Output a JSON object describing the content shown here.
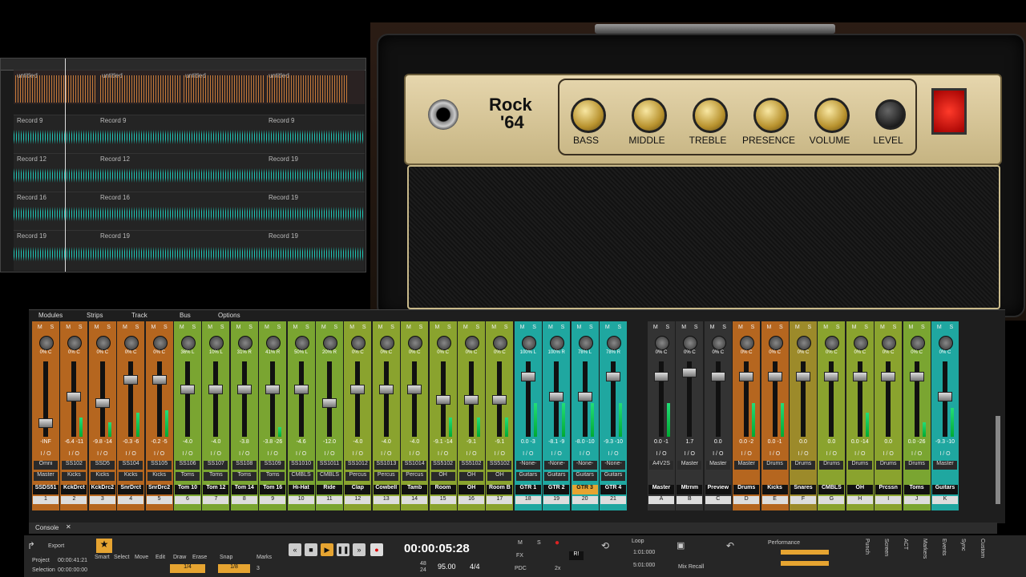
{
  "trackview": {
    "bus_clips": [
      {
        "label": "untitled"
      },
      {
        "label": "untitled"
      },
      {
        "label": "untitled"
      },
      {
        "label": "untitled"
      }
    ],
    "tracks": [
      {
        "clips": [
          "Record 9",
          "Record 9",
          "Record 9"
        ]
      },
      {
        "clips": [
          "Record 12",
          "Record 12",
          "Record 19"
        ]
      },
      {
        "clips": [
          "Record 16",
          "Record 16",
          "Record 19"
        ]
      },
      {
        "clips": [
          "Record 19",
          "Record 19",
          "Record 19"
        ]
      }
    ]
  },
  "amp": {
    "title_line1": "Rock",
    "title_line2": "'64",
    "knobs": [
      "BASS",
      "MIDDLE",
      "TREBLE",
      "PRESENCE",
      "VOLUME",
      "LEVEL"
    ]
  },
  "console": {
    "menu": [
      "Modules",
      "Strips",
      "Track",
      "Bus",
      "Options"
    ],
    "tab": "Console",
    "io_label": "I / O",
    "strips": [
      {
        "pot": "0% C",
        "vals": "-INF",
        "in": "Omni",
        "out": "Master",
        "name": "SSDS51",
        "num": "1",
        "color": "#b5661f",
        "fader": 0.85,
        "meter": 0
      },
      {
        "pot": "0% C",
        "vals": "-6.4 -11",
        "in": "SS102",
        "out": "Kicks",
        "name": "KckDrct",
        "num": "2",
        "color": "#b5661f",
        "fader": 0.45,
        "meter": 0.4
      },
      {
        "pot": "0% C",
        "vals": "-9.8 -14",
        "in": "SSD5",
        "out": "Kicks",
        "name": "KckDrc2",
        "num": "3",
        "color": "#b5661f",
        "fader": 0.55,
        "meter": 0.3
      },
      {
        "pot": "0% C",
        "vals": "-0.3 -6",
        "in": "SS104",
        "out": "Kicks",
        "name": "SnrDrct",
        "num": "4",
        "color": "#b5661f",
        "fader": 0.2,
        "meter": 0.5
      },
      {
        "pot": "0% C",
        "vals": "-0.2 -5",
        "in": "SS105",
        "out": "Kicks",
        "name": "SnrDrc2",
        "num": "5",
        "color": "#b5661f",
        "fader": 0.2,
        "meter": 0.55
      },
      {
        "pot": "36% L",
        "vals": "-4.0",
        "in": "SS106",
        "out": "Toms",
        "name": "Tom 10",
        "num": "6",
        "color": "#7aa531",
        "fader": 0.35,
        "meter": 0
      },
      {
        "pot": "10% L",
        "vals": "-4.0",
        "in": "SS107",
        "out": "Toms",
        "name": "Tom 12",
        "num": "7",
        "color": "#7aa531",
        "fader": 0.35,
        "meter": 0
      },
      {
        "pot": "31% R",
        "vals": "-3.8",
        "in": "SS108",
        "out": "Toms",
        "name": "Tom 14",
        "num": "8",
        "color": "#7aa531",
        "fader": 0.35,
        "meter": 0
      },
      {
        "pot": "41% R",
        "vals": "-3.8 -26",
        "in": "SS109",
        "out": "Toms",
        "name": "Tom 16",
        "num": "9",
        "color": "#7aa531",
        "fader": 0.35,
        "meter": 0.2
      },
      {
        "pot": "50% L",
        "vals": "-4.6",
        "in": "SS1010",
        "out": "CMBLS",
        "name": "Hi-Hat",
        "num": "10",
        "color": "#7aa531",
        "fader": 0.35,
        "meter": 0
      },
      {
        "pot": "20% R",
        "vals": "-12.0",
        "in": "SS1011",
        "out": "CMBLS",
        "name": "Ride",
        "num": "11",
        "color": "#7aa531",
        "fader": 0.55,
        "meter": 0
      },
      {
        "pot": "0% C",
        "vals": "-4.0",
        "in": "SS1012",
        "out": "Percus",
        "name": "Clap",
        "num": "12",
        "color": "#8aa32e",
        "fader": 0.35,
        "meter": 0
      },
      {
        "pot": "0% C",
        "vals": "-4.0",
        "in": "SS1013",
        "out": "Percus",
        "name": "Cowbell",
        "num": "13",
        "color": "#8aa32e",
        "fader": 0.35,
        "meter": 0
      },
      {
        "pot": "0% C",
        "vals": "-4.0",
        "in": "SS1014",
        "out": "Percus",
        "name": "Tamb",
        "num": "14",
        "color": "#8aa32e",
        "fader": 0.35,
        "meter": 0
      },
      {
        "pot": "0% C",
        "vals": "-9.1 -14",
        "in": "SS5102",
        "out": "OH",
        "name": "Room",
        "num": "15",
        "color": "#8aa32e",
        "fader": 0.5,
        "meter": 0.4
      },
      {
        "pot": "0% C",
        "vals": "-9.1",
        "in": "SS5102",
        "out": "OH",
        "name": "OH",
        "num": "16",
        "color": "#8aa32e",
        "fader": 0.5,
        "meter": 0.4
      },
      {
        "pot": "0% C",
        "vals": "-9.1",
        "in": "SS5102",
        "out": "OH",
        "name": "Room B",
        "num": "17",
        "color": "#8aa32e",
        "fader": 0.5,
        "meter": 0.4
      },
      {
        "pot": "100% L",
        "vals": "0.0 -3",
        "in": "-None-",
        "out": "Guitars",
        "name": "GTR 1",
        "num": "18",
        "color": "#1fa7a0",
        "fader": 0.15,
        "meter": 0.7
      },
      {
        "pot": "100% R",
        "vals": "-8.1 -9",
        "in": "-None-",
        "out": "Guitars",
        "name": "GTR 2",
        "num": "19",
        "color": "#1fa7a0",
        "fader": 0.45,
        "meter": 0.7
      },
      {
        "pot": "78% L",
        "vals": "-8.0 -10",
        "in": "-None-",
        "out": "Guitars",
        "name": "GTR 3",
        "num": "20",
        "color": "#1fa7a0",
        "fader": 0.45,
        "meter": 0.7,
        "highlight": true
      },
      {
        "pot": "78% R",
        "vals": "-9.3 -10",
        "in": "-None-",
        "out": "Guitars",
        "name": "GTR 4",
        "num": "21",
        "color": "#1fa7a0",
        "fader": 0.15,
        "meter": 0.7
      }
    ],
    "buses": [
      {
        "pot": "0% C",
        "vals": "0.0 -1",
        "in": "A4V2S",
        "out": "",
        "name": "Master",
        "num": "A",
        "color": "#333",
        "fader": 0.15,
        "meter": 0.7
      },
      {
        "pot": "0% C",
        "vals": "1.7",
        "in": "Master",
        "out": "",
        "name": "Mtrnm",
        "num": "B",
        "color": "#333",
        "fader": 0.1,
        "meter": 0
      },
      {
        "pot": "0% C",
        "vals": "0.0",
        "in": "Master",
        "out": "",
        "name": "Preview",
        "num": "C",
        "color": "#333",
        "fader": 0.15,
        "meter": 0
      },
      {
        "pot": "0% C",
        "vals": "0.0 -2",
        "in": "Master",
        "out": "",
        "name": "Drums",
        "num": "D",
        "color": "#b5661f",
        "fader": 0.15,
        "meter": 0.7
      },
      {
        "pot": "0% C",
        "vals": "0.0 -1",
        "in": "Drums",
        "out": "",
        "name": "Kicks",
        "num": "E",
        "color": "#b5661f",
        "fader": 0.15,
        "meter": 0.7
      },
      {
        "pot": "0% C",
        "vals": "0.0",
        "in": "Drums",
        "out": "",
        "name": "Snares",
        "num": "F",
        "color": "#9c8a2a",
        "fader": 0.15,
        "meter": 0
      },
      {
        "pot": "0% C",
        "vals": "0.0",
        "in": "Drums",
        "out": "",
        "name": "CMBLS",
        "num": "G",
        "color": "#8aa32e",
        "fader": 0.15,
        "meter": 0
      },
      {
        "pot": "0% C",
        "vals": "0.0 -14",
        "in": "Drums",
        "out": "",
        "name": "OH",
        "num": "H",
        "color": "#8aa32e",
        "fader": 0.15,
        "meter": 0.5
      },
      {
        "pot": "0% C",
        "vals": "0.0",
        "in": "Drums",
        "out": "",
        "name": "Prcssn",
        "num": "I",
        "color": "#8aa32e",
        "fader": 0.15,
        "meter": 0
      },
      {
        "pot": "0% C",
        "vals": "0.0 -26",
        "in": "Drums",
        "out": "",
        "name": "Toms",
        "num": "J",
        "color": "#7aa531",
        "fader": 0.15,
        "meter": 0.3
      },
      {
        "pot": "0% C",
        "vals": "-9.3 -10",
        "in": "Master",
        "out": "",
        "name": "Guitars",
        "num": "K",
        "color": "#1fa7a0",
        "fader": 0.45,
        "meter": 0.6
      }
    ]
  },
  "controlbar": {
    "export": "Export",
    "project": "Project",
    "project_time": "00:00:41:21",
    "selection": "Selection",
    "selection_time": "00:00:00:00",
    "tools": [
      "Smart",
      "Select",
      "Move",
      "Edit",
      "Draw",
      "Erase"
    ],
    "tool_snap": "1/4",
    "snap_label": "Snap",
    "marks_label": "Marks",
    "snap_value": "1/8",
    "snap_count": "3",
    "time": "00:00:05:28",
    "tempo": "95.00",
    "meter": "4/4",
    "beats": "48",
    "beats2": "24",
    "mix_m": "M",
    "mix_s": "S",
    "fx": "FX",
    "pdc": "PDC",
    "r1": "R!",
    "x2": "2x",
    "loop": "Loop",
    "loop_start": "1:01:000",
    "loop_end": "5:01:000",
    "mix_recall": "Mix Recall",
    "performance": "Performance",
    "side_tabs": [
      "Punch",
      "Screen",
      "ACT",
      "Markers",
      "Events",
      "Sync",
      "Custom"
    ]
  }
}
